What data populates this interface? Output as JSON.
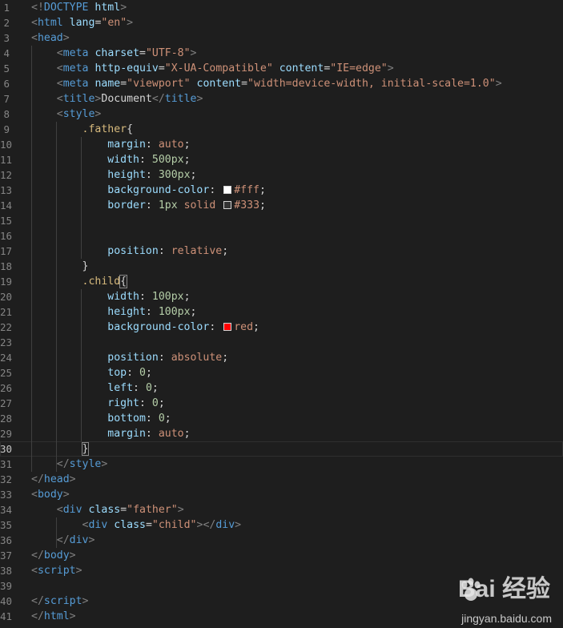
{
  "editor": {
    "current_line": 30,
    "lines": [
      {
        "n": "1",
        "tokens": [
          {
            "c": "t-punc",
            "t": "<!"
          },
          {
            "c": "t-tag",
            "t": "DOCTYPE"
          },
          {
            "c": "t-text",
            "t": " "
          },
          {
            "c": "t-attr",
            "t": "html"
          },
          {
            "c": "t-punc",
            "t": ">"
          }
        ]
      },
      {
        "n": "2",
        "tokens": [
          {
            "c": "t-punc",
            "t": "<"
          },
          {
            "c": "t-tag",
            "t": "html"
          },
          {
            "c": "t-text",
            "t": " "
          },
          {
            "c": "t-attr",
            "t": "lang"
          },
          {
            "c": "t-text",
            "t": "="
          },
          {
            "c": "t-str",
            "t": "\"en\""
          },
          {
            "c": "t-punc",
            "t": ">"
          }
        ]
      },
      {
        "n": "3",
        "tokens": [
          {
            "c": "t-punc",
            "t": "<"
          },
          {
            "c": "t-tag",
            "t": "head"
          },
          {
            "c": "t-punc",
            "t": ">"
          }
        ]
      },
      {
        "n": "4",
        "tokens": [
          {
            "c": "t-text",
            "t": "    "
          },
          {
            "c": "t-punc",
            "t": "<"
          },
          {
            "c": "t-tag",
            "t": "meta"
          },
          {
            "c": "t-text",
            "t": " "
          },
          {
            "c": "t-attr",
            "t": "charset"
          },
          {
            "c": "t-text",
            "t": "="
          },
          {
            "c": "t-str",
            "t": "\"UTF-8\""
          },
          {
            "c": "t-punc",
            "t": ">"
          }
        ]
      },
      {
        "n": "5",
        "tokens": [
          {
            "c": "t-text",
            "t": "    "
          },
          {
            "c": "t-punc",
            "t": "<"
          },
          {
            "c": "t-tag",
            "t": "meta"
          },
          {
            "c": "t-text",
            "t": " "
          },
          {
            "c": "t-attr",
            "t": "http-equiv"
          },
          {
            "c": "t-text",
            "t": "="
          },
          {
            "c": "t-str",
            "t": "\"X-UA-Compatible\""
          },
          {
            "c": "t-text",
            "t": " "
          },
          {
            "c": "t-attr",
            "t": "content"
          },
          {
            "c": "t-text",
            "t": "="
          },
          {
            "c": "t-str",
            "t": "\"IE=edge\""
          },
          {
            "c": "t-punc",
            "t": ">"
          }
        ]
      },
      {
        "n": "6",
        "tokens": [
          {
            "c": "t-text",
            "t": "    "
          },
          {
            "c": "t-punc",
            "t": "<"
          },
          {
            "c": "t-tag",
            "t": "meta"
          },
          {
            "c": "t-text",
            "t": " "
          },
          {
            "c": "t-attr",
            "t": "name"
          },
          {
            "c": "t-text",
            "t": "="
          },
          {
            "c": "t-str",
            "t": "\"viewport\""
          },
          {
            "c": "t-text",
            "t": " "
          },
          {
            "c": "t-attr",
            "t": "content"
          },
          {
            "c": "t-text",
            "t": "="
          },
          {
            "c": "t-str",
            "t": "\"width=device-width, initial-scale=1.0\""
          },
          {
            "c": "t-punc",
            "t": ">"
          }
        ]
      },
      {
        "n": "7",
        "tokens": [
          {
            "c": "t-text",
            "t": "    "
          },
          {
            "c": "t-punc",
            "t": "<"
          },
          {
            "c": "t-tag",
            "t": "title"
          },
          {
            "c": "t-punc",
            "t": ">"
          },
          {
            "c": "t-text",
            "t": "Document"
          },
          {
            "c": "t-punc",
            "t": "</"
          },
          {
            "c": "t-tag",
            "t": "title"
          },
          {
            "c": "t-punc",
            "t": ">"
          }
        ]
      },
      {
        "n": "8",
        "tokens": [
          {
            "c": "t-text",
            "t": "    "
          },
          {
            "c": "t-punc",
            "t": "<"
          },
          {
            "c": "t-tag",
            "t": "style"
          },
          {
            "c": "t-punc",
            "t": ">"
          }
        ]
      },
      {
        "n": "9",
        "tokens": [
          {
            "c": "t-text",
            "t": "        "
          },
          {
            "c": "t-sel",
            "t": ".father"
          },
          {
            "c": "t-brace",
            "t": "{"
          }
        ]
      },
      {
        "n": "10",
        "tokens": [
          {
            "c": "t-text",
            "t": "            "
          },
          {
            "c": "t-prop",
            "t": "margin"
          },
          {
            "c": "t-text",
            "t": ": "
          },
          {
            "c": "t-val",
            "t": "auto"
          },
          {
            "c": "t-text",
            "t": ";"
          }
        ]
      },
      {
        "n": "11",
        "tokens": [
          {
            "c": "t-text",
            "t": "            "
          },
          {
            "c": "t-prop",
            "t": "width"
          },
          {
            "c": "t-text",
            "t": ": "
          },
          {
            "c": "t-num",
            "t": "500px"
          },
          {
            "c": "t-text",
            "t": ";"
          }
        ]
      },
      {
        "n": "12",
        "tokens": [
          {
            "c": "t-text",
            "t": "            "
          },
          {
            "c": "t-prop",
            "t": "height"
          },
          {
            "c": "t-text",
            "t": ": "
          },
          {
            "c": "t-num",
            "t": "300px"
          },
          {
            "c": "t-text",
            "t": ";"
          }
        ]
      },
      {
        "n": "13",
        "tokens": [
          {
            "c": "t-text",
            "t": "            "
          },
          {
            "c": "t-prop",
            "t": "background-color"
          },
          {
            "c": "t-text",
            "t": ": "
          },
          {
            "c": "swatch",
            "t": "#ffffff"
          },
          {
            "c": "t-val",
            "t": "#fff"
          },
          {
            "c": "t-text",
            "t": ";"
          }
        ]
      },
      {
        "n": "14",
        "tokens": [
          {
            "c": "t-text",
            "t": "            "
          },
          {
            "c": "t-prop",
            "t": "border"
          },
          {
            "c": "t-text",
            "t": ": "
          },
          {
            "c": "t-num",
            "t": "1px"
          },
          {
            "c": "t-text",
            "t": " "
          },
          {
            "c": "t-val",
            "t": "solid"
          },
          {
            "c": "t-text",
            "t": " "
          },
          {
            "c": "swatch",
            "t": "#333333"
          },
          {
            "c": "t-val",
            "t": "#333"
          },
          {
            "c": "t-text",
            "t": ";"
          }
        ]
      },
      {
        "n": "15",
        "tokens": []
      },
      {
        "n": "16",
        "tokens": []
      },
      {
        "n": "17",
        "tokens": [
          {
            "c": "t-text",
            "t": "            "
          },
          {
            "c": "t-prop",
            "t": "position"
          },
          {
            "c": "t-text",
            "t": ": "
          },
          {
            "c": "t-val",
            "t": "relative"
          },
          {
            "c": "t-text",
            "t": ";"
          }
        ]
      },
      {
        "n": "18",
        "tokens": [
          {
            "c": "t-text",
            "t": "        "
          },
          {
            "c": "t-brace",
            "t": "}"
          }
        ]
      },
      {
        "n": "19",
        "tokens": [
          {
            "c": "t-text",
            "t": "        "
          },
          {
            "c": "t-sel",
            "t": ".child"
          },
          {
            "c": "t-brace-match",
            "t": "{"
          }
        ]
      },
      {
        "n": "20",
        "tokens": [
          {
            "c": "t-text",
            "t": "            "
          },
          {
            "c": "t-prop",
            "t": "width"
          },
          {
            "c": "t-text",
            "t": ": "
          },
          {
            "c": "t-num",
            "t": "100px"
          },
          {
            "c": "t-text",
            "t": ";"
          }
        ]
      },
      {
        "n": "21",
        "tokens": [
          {
            "c": "t-text",
            "t": "            "
          },
          {
            "c": "t-prop",
            "t": "height"
          },
          {
            "c": "t-text",
            "t": ": "
          },
          {
            "c": "t-num",
            "t": "100px"
          },
          {
            "c": "t-text",
            "t": ";"
          }
        ]
      },
      {
        "n": "22",
        "tokens": [
          {
            "c": "t-text",
            "t": "            "
          },
          {
            "c": "t-prop",
            "t": "background-color"
          },
          {
            "c": "t-text",
            "t": ": "
          },
          {
            "c": "swatch",
            "t": "#ff0000"
          },
          {
            "c": "t-val",
            "t": "red"
          },
          {
            "c": "t-text",
            "t": ";"
          }
        ]
      },
      {
        "n": "23",
        "tokens": []
      },
      {
        "n": "24",
        "tokens": [
          {
            "c": "t-text",
            "t": "            "
          },
          {
            "c": "t-prop",
            "t": "position"
          },
          {
            "c": "t-text",
            "t": ": "
          },
          {
            "c": "t-val",
            "t": "absolute"
          },
          {
            "c": "t-text",
            "t": ";"
          }
        ]
      },
      {
        "n": "25",
        "tokens": [
          {
            "c": "t-text",
            "t": "            "
          },
          {
            "c": "t-prop",
            "t": "top"
          },
          {
            "c": "t-text",
            "t": ": "
          },
          {
            "c": "t-num",
            "t": "0"
          },
          {
            "c": "t-text",
            "t": ";"
          }
        ]
      },
      {
        "n": "26",
        "tokens": [
          {
            "c": "t-text",
            "t": "            "
          },
          {
            "c": "t-prop",
            "t": "left"
          },
          {
            "c": "t-text",
            "t": ": "
          },
          {
            "c": "t-num",
            "t": "0"
          },
          {
            "c": "t-text",
            "t": ";"
          }
        ]
      },
      {
        "n": "27",
        "tokens": [
          {
            "c": "t-text",
            "t": "            "
          },
          {
            "c": "t-prop",
            "t": "right"
          },
          {
            "c": "t-text",
            "t": ": "
          },
          {
            "c": "t-num",
            "t": "0"
          },
          {
            "c": "t-text",
            "t": ";"
          }
        ]
      },
      {
        "n": "28",
        "tokens": [
          {
            "c": "t-text",
            "t": "            "
          },
          {
            "c": "t-prop",
            "t": "bottom"
          },
          {
            "c": "t-text",
            "t": ": "
          },
          {
            "c": "t-num",
            "t": "0"
          },
          {
            "c": "t-text",
            "t": ";"
          }
        ]
      },
      {
        "n": "29",
        "tokens": [
          {
            "c": "t-text",
            "t": "            "
          },
          {
            "c": "t-prop",
            "t": "margin"
          },
          {
            "c": "t-text",
            "t": ": "
          },
          {
            "c": "t-val",
            "t": "auto"
          },
          {
            "c": "t-text",
            "t": ";"
          }
        ]
      },
      {
        "n": "30",
        "tokens": [
          {
            "c": "t-text",
            "t": "        "
          },
          {
            "c": "t-brace-match",
            "t": "}"
          }
        ]
      },
      {
        "n": "31",
        "tokens": [
          {
            "c": "t-text",
            "t": "    "
          },
          {
            "c": "t-punc",
            "t": "</"
          },
          {
            "c": "t-tag",
            "t": "style"
          },
          {
            "c": "t-punc",
            "t": ">"
          }
        ]
      },
      {
        "n": "32",
        "tokens": [
          {
            "c": "t-punc",
            "t": "</"
          },
          {
            "c": "t-tag",
            "t": "head"
          },
          {
            "c": "t-punc",
            "t": ">"
          }
        ]
      },
      {
        "n": "33",
        "tokens": [
          {
            "c": "t-punc",
            "t": "<"
          },
          {
            "c": "t-tag",
            "t": "body"
          },
          {
            "c": "t-punc",
            "t": ">"
          }
        ]
      },
      {
        "n": "34",
        "tokens": [
          {
            "c": "t-text",
            "t": "    "
          },
          {
            "c": "t-punc",
            "t": "<"
          },
          {
            "c": "t-tag",
            "t": "div"
          },
          {
            "c": "t-text",
            "t": " "
          },
          {
            "c": "t-attr",
            "t": "class"
          },
          {
            "c": "t-text",
            "t": "="
          },
          {
            "c": "t-str",
            "t": "\"father\""
          },
          {
            "c": "t-punc",
            "t": ">"
          }
        ]
      },
      {
        "n": "35",
        "tokens": [
          {
            "c": "t-text",
            "t": "        "
          },
          {
            "c": "t-punc",
            "t": "<"
          },
          {
            "c": "t-tag",
            "t": "div"
          },
          {
            "c": "t-text",
            "t": " "
          },
          {
            "c": "t-attr",
            "t": "class"
          },
          {
            "c": "t-text",
            "t": "="
          },
          {
            "c": "t-str",
            "t": "\"child\""
          },
          {
            "c": "t-punc",
            "t": "></"
          },
          {
            "c": "t-tag",
            "t": "div"
          },
          {
            "c": "t-punc",
            "t": ">"
          }
        ]
      },
      {
        "n": "36",
        "tokens": [
          {
            "c": "t-text",
            "t": "    "
          },
          {
            "c": "t-punc",
            "t": "</"
          },
          {
            "c": "t-tag",
            "t": "div"
          },
          {
            "c": "t-punc",
            "t": ">"
          }
        ]
      },
      {
        "n": "37",
        "tokens": [
          {
            "c": "t-punc",
            "t": "</"
          },
          {
            "c": "t-tag",
            "t": "body"
          },
          {
            "c": "t-punc",
            "t": ">"
          }
        ]
      },
      {
        "n": "38",
        "tokens": [
          {
            "c": "t-punc",
            "t": "<"
          },
          {
            "c": "t-tag",
            "t": "script"
          },
          {
            "c": "t-punc",
            "t": ">"
          }
        ]
      },
      {
        "n": "39",
        "tokens": []
      },
      {
        "n": "40",
        "tokens": [
          {
            "c": "t-punc",
            "t": "</"
          },
          {
            "c": "t-tag",
            "t": "script"
          },
          {
            "c": "t-punc",
            "t": ">"
          }
        ]
      },
      {
        "n": "41",
        "tokens": [
          {
            "c": "t-punc",
            "t": "</"
          },
          {
            "c": "t-tag",
            "t": "html"
          },
          {
            "c": "t-punc",
            "t": ">"
          }
        ]
      }
    ]
  },
  "watermark": {
    "logo": "Bai  经验",
    "url": "jingyan.baidu.com"
  }
}
